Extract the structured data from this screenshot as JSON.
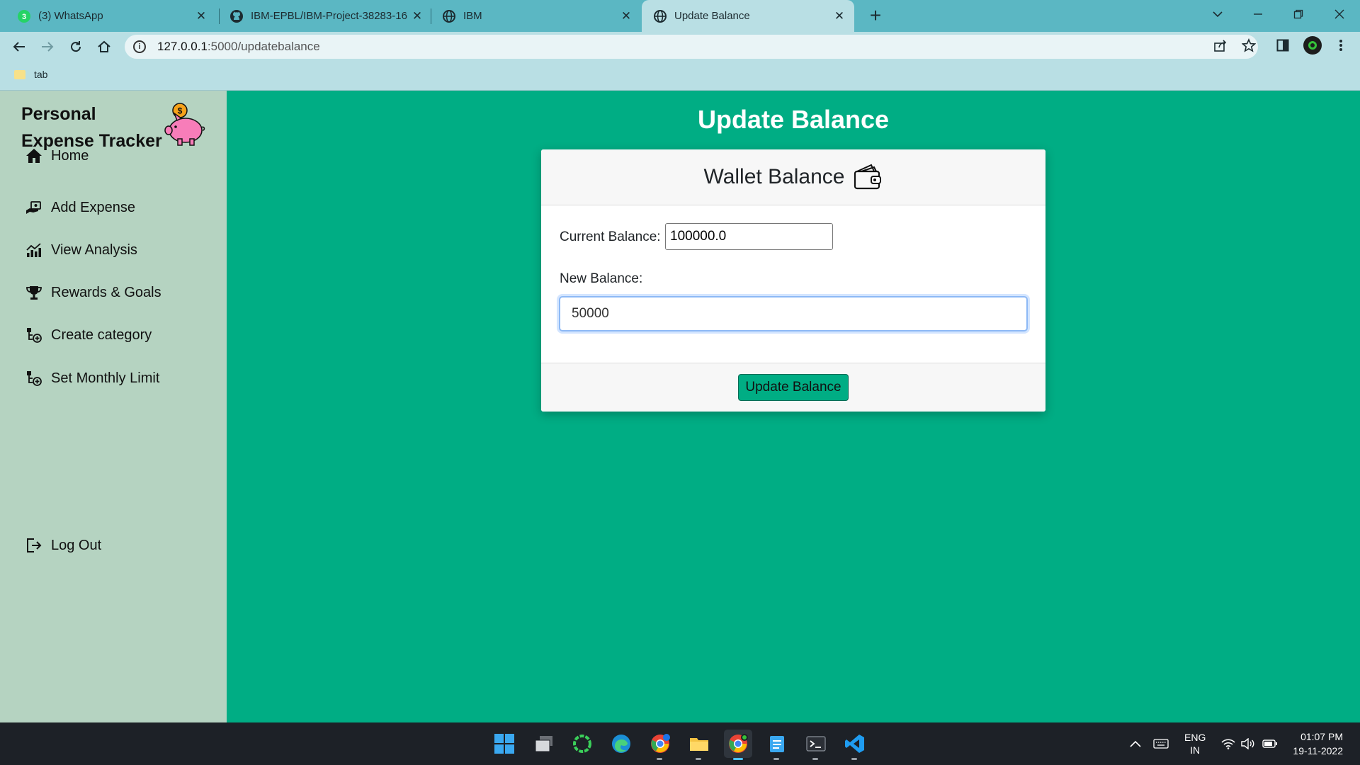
{
  "browser": {
    "tabs": [
      {
        "title": "(3) WhatsApp",
        "icon": "whatsapp-icon",
        "active": false
      },
      {
        "title": "IBM-EPBL/IBM-Project-38283-16",
        "icon": "github-icon",
        "active": false
      },
      {
        "title": "IBM",
        "icon": "globe-icon",
        "active": false
      },
      {
        "title": "Update Balance",
        "icon": "globe-icon",
        "active": true
      }
    ],
    "url_host": "127.0.0.1",
    "url_path": ":5000/updatebalance",
    "bookmark": "tab"
  },
  "sidebar": {
    "brand_line1": "Personal",
    "brand_line2": "Expense Tracker",
    "items": [
      {
        "label": "Home",
        "icon": "home-icon"
      },
      {
        "label": "Add Expense",
        "icon": "add-expense-icon"
      },
      {
        "label": "View Analysis",
        "icon": "chart-icon"
      },
      {
        "label": "Rewards & Goals",
        "icon": "trophy-icon"
      },
      {
        "label": "Create category",
        "icon": "category-icon"
      },
      {
        "label": "Set Monthly Limit",
        "icon": "limit-icon"
      }
    ],
    "logout": "Log Out"
  },
  "main": {
    "page_title": "Update Balance",
    "card_title": "Wallet Balance",
    "current_label": "Current Balance:",
    "current_value": "100000.0",
    "new_label": "New Balance:",
    "new_value": "50000",
    "submit_label": "Update Balance"
  },
  "taskbar": {
    "lang_line1": "ENG",
    "lang_line2": "IN",
    "time": "01:07 PM",
    "date": "19-11-2022"
  },
  "colors": {
    "accent": "#00ad84",
    "sidebar": "#b5d3c1",
    "chrome": "#5bb7c3"
  }
}
